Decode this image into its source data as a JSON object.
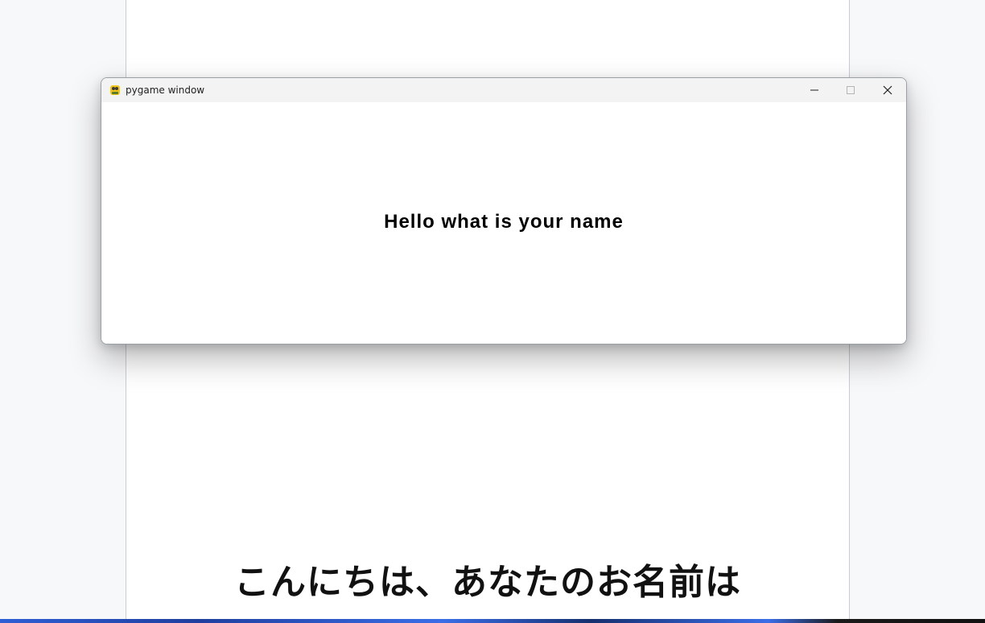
{
  "window": {
    "title": "pygame window",
    "icon": "pygame-snake-icon",
    "controls": {
      "minimize_icon": "minimize-icon",
      "maximize_icon": "maximize-icon",
      "close_icon": "close-icon"
    },
    "content_text": "Hello what is your name"
  },
  "background_page": {
    "subtitle": "こんにちは、あなたのお名前は"
  },
  "colors": {
    "desktop": "#f7f8fa",
    "titlebar": "#f3f3f3",
    "window_content": "#ffffff",
    "text": "#000000"
  }
}
